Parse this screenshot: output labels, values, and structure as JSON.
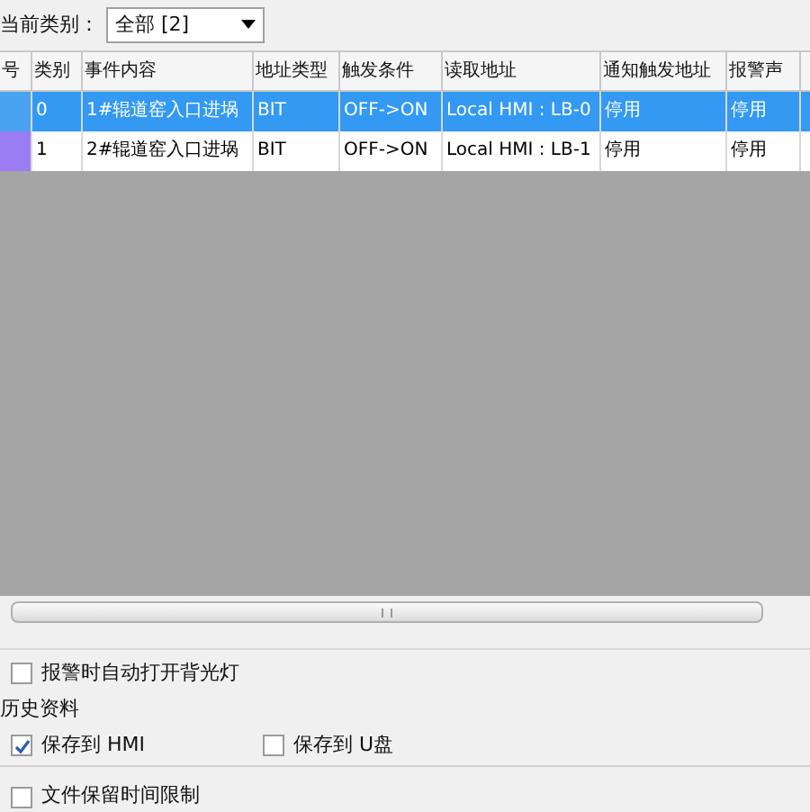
{
  "filter": {
    "label": "当前类别：",
    "value": "全部 [2]"
  },
  "table": {
    "columns": [
      "号",
      "类别",
      "事件内容",
      "地址类型",
      "触发条件",
      "读取地址",
      "通知触发地址",
      "报警声"
    ],
    "rows": [
      {
        "selected": true,
        "color": "#4aa3f0",
        "cells": [
          "",
          "0",
          "1#辊道窑入口进埚",
          "BIT",
          "OFF->ON",
          "Local HMI : LB-0",
          "停用",
          "停用"
        ]
      },
      {
        "selected": false,
        "color": "#9b7cf2",
        "cells": [
          "",
          "1",
          "2#辊道窑入口进埚",
          "BIT",
          "OFF->ON",
          "Local HMI : LB-1",
          "停用",
          "停用"
        ]
      }
    ]
  },
  "backlight": {
    "label": "报警时自动打开背光灯",
    "checked": false
  },
  "history": {
    "title": "历史资料",
    "options": [
      {
        "label": "保存到 HMI",
        "checked": true
      },
      {
        "label": "保存到 U盘",
        "checked": false
      }
    ]
  },
  "retention": {
    "label": "文件保留时间限制",
    "checked": false
  }
}
